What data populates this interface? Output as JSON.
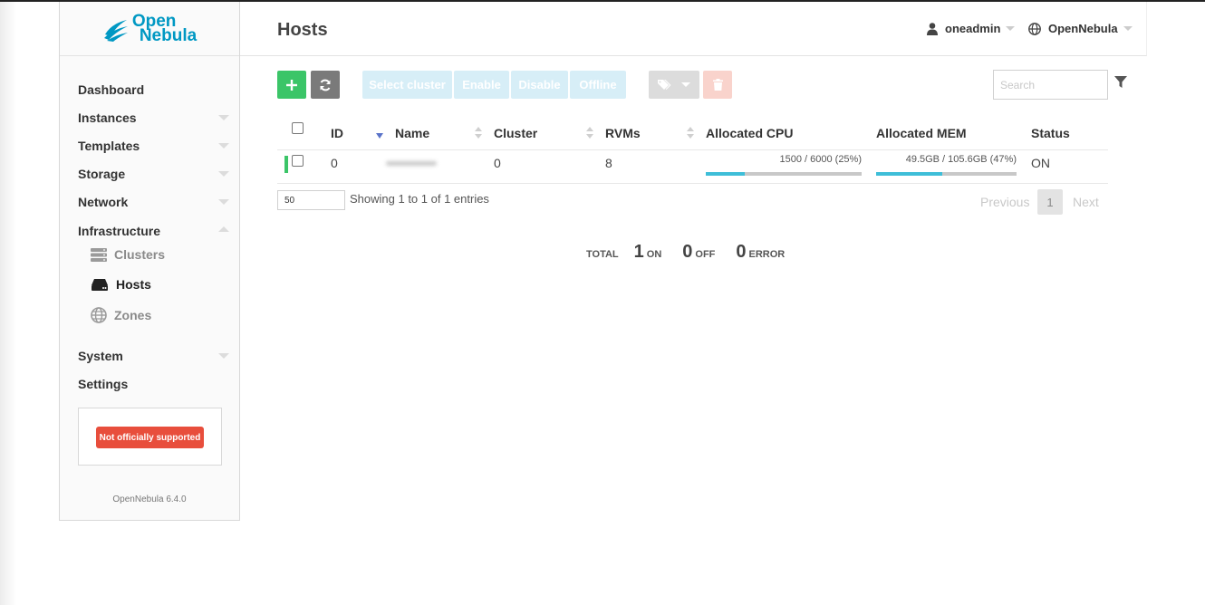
{
  "app": {
    "logo_line1": "Open",
    "logo_line2": "Nebula",
    "brand_color": "#0098c3"
  },
  "header": {
    "title": "Hosts",
    "user": "oneadmin",
    "zone": "OpenNebula"
  },
  "sidebar": {
    "items": [
      {
        "label": "Dashboard"
      },
      {
        "label": "Instances"
      },
      {
        "label": "Templates"
      },
      {
        "label": "Storage"
      },
      {
        "label": "Network"
      },
      {
        "label": "Infrastructure"
      },
      {
        "label": "System"
      },
      {
        "label": "Settings"
      }
    ],
    "infrastructure_sub": [
      {
        "label": "Clusters",
        "icon": "server-icon"
      },
      {
        "label": "Hosts",
        "icon": "hdd-icon",
        "active": true
      },
      {
        "label": "Zones",
        "icon": "globe-icon"
      }
    ],
    "notice": "Not officially supported",
    "version": "OpenNebula 6.4.0"
  },
  "toolbar": {
    "create_icon": "plus-icon",
    "refresh_icon": "refresh-icon",
    "select_cluster": "Select cluster",
    "enable": "Enable",
    "disable": "Disable",
    "offline": "Offline",
    "labels_icon": "tags-icon",
    "delete_icon": "trash-icon",
    "search_placeholder": "Search",
    "filter_icon": "filter-icon"
  },
  "table": {
    "columns": [
      "ID",
      "Name",
      "Cluster",
      "RVMs",
      "Allocated CPU",
      "Allocated MEM",
      "Status"
    ],
    "rows": [
      {
        "id": "0",
        "name": "",
        "cluster": "0",
        "rvms": "8",
        "cpu_text": "1500 / 6000 (25%)",
        "cpu_percent": 25,
        "mem_text": "49.5GB / 105.6GB (47%)",
        "mem_percent": 47,
        "status": "ON"
      }
    ]
  },
  "pager": {
    "page_size": "50",
    "info": "Showing 1 to 1 of 1 entries",
    "previous": "Previous",
    "current_page": "1",
    "next": "Next"
  },
  "totals": {
    "total_label": "TOTAL",
    "on_count": "1",
    "on_label": "ON",
    "off_count": "0",
    "off_label": "OFF",
    "error_count": "0",
    "error_label": "ERROR"
  }
}
